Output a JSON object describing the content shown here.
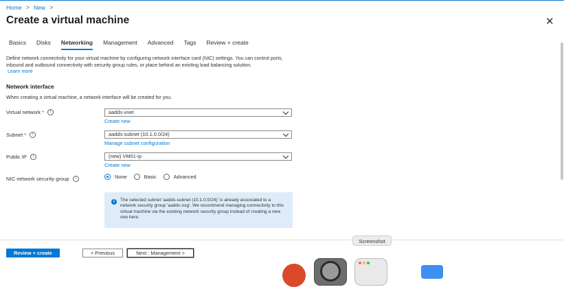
{
  "breadcrumb": {
    "items": [
      "Home",
      "New"
    ]
  },
  "page": {
    "title": "Create a virtual machine"
  },
  "tabs": [
    {
      "label": "Basics"
    },
    {
      "label": "Disks"
    },
    {
      "label": "Networking"
    },
    {
      "label": "Management"
    },
    {
      "label": "Advanced"
    },
    {
      "label": "Tags"
    },
    {
      "label": "Review + create"
    }
  ],
  "active_tab": "Networking",
  "intro": {
    "text": "Define network connectivity for your virtual machine by configuring network interface card (NIC) settings. You can control ports, inbound and outbound connectivity with security group rules, or place behind an existing load balancing solution.",
    "link": "Learn more"
  },
  "network_interface": {
    "title": "Network interface",
    "description": "When creating a virtual machine, a network interface will be created for you."
  },
  "fields": {
    "vnet": {
      "label": "Virtual network",
      "required": "*",
      "value": "aadds-vnet",
      "link": "Create new"
    },
    "subnet": {
      "label": "Subnet",
      "required": "*",
      "value": "aadds-subnet (10.1.0.0/24)",
      "link": "Manage subnet configuration"
    },
    "public_ip": {
      "label": "Public IP",
      "value": "(new) VM01-ip",
      "link": "Create new"
    },
    "nsg": {
      "label": "NIC network security group",
      "options": [
        "None",
        "Basic",
        "Advanced"
      ],
      "selected": "None"
    }
  },
  "info_message": "The selected subnet 'aadds-subnet (10.1.0.0/24)' is already associated to a network security group 'aadds-nsg'. We recommend managing connectivity to this virtual machine via the existing network security group instead of creating a new one here.",
  "footer": {
    "review_label": "Review + create",
    "previous_label": "< Previous",
    "next_label": "Next : Management >"
  },
  "tooltip": "Screenshot",
  "icons": {
    "info": "info-icon",
    "close": "close-icon",
    "chevron": "chevron-down-icon"
  },
  "colors": {
    "accent": "#0078d4",
    "required": "#a4262c",
    "info_background": "#deecf9"
  }
}
